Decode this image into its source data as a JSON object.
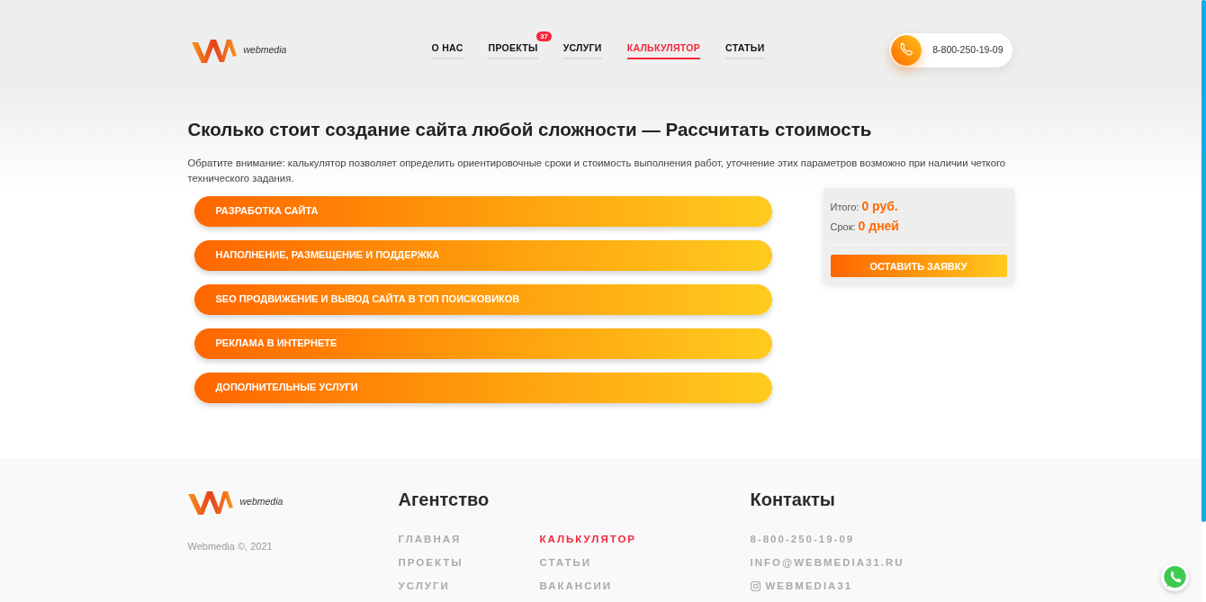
{
  "header": {
    "logo_text": "webmedia",
    "nav": [
      {
        "label": "О НАС",
        "selected": false
      },
      {
        "label": "ПРОЕКТЫ",
        "selected": false,
        "badge": "37"
      },
      {
        "label": "УСЛУГИ",
        "selected": false
      },
      {
        "label": "КАЛЬКУЛЯТОР",
        "selected": true
      },
      {
        "label": "СТАТЬИ",
        "selected": false
      }
    ],
    "phone": "8-800-250-19-09"
  },
  "calculator": {
    "title": "Сколько стоит создание сайта любой сложности — Рассчитать стоимость",
    "note": "Обратите внимание: калькулятор позволяет определить ориентировочные сроки и стоимость выполнения работ, уточнение этих параметров возможно при наличии четкого технического задания.",
    "sections": [
      {
        "label": "РАЗРАБОТКА САЙТА"
      },
      {
        "label": "НАПОЛНЕНИЕ, РАЗМЕЩЕНИЕ И ПОДДЕРЖКА"
      },
      {
        "label": "SEO ПРОДВИЖЕНИЕ И ВЫВОД САЙТА В ТОП ПОИСКОВИКОВ"
      },
      {
        "label": "РЕКЛАМА В ИНТЕРНЕТЕ"
      },
      {
        "label": "ДОПОЛНИТЕЛЬНЫЕ УСЛУГИ"
      }
    ],
    "summary": {
      "total_label": "Итого:",
      "total_value": "0 руб.",
      "term_label": "Срок:",
      "term_value": "0 дней",
      "button": "ОСТАВИТЬ ЗАЯВКУ"
    }
  },
  "footer": {
    "logo_text": "webmedia",
    "copyright": "Webmedia ©, 2021",
    "agency": {
      "title": "Агентство",
      "links": [
        {
          "label": "ГЛАВНАЯ",
          "selected": false
        },
        {
          "label": "ПРОЕКТЫ",
          "selected": false
        },
        {
          "label": "УСЛУГИ",
          "selected": false
        },
        {
          "label": "КАЛЬКУЛЯТОР",
          "selected": true
        },
        {
          "label": "СТАТЬИ",
          "selected": false
        },
        {
          "label": "ВАКАНСИИ",
          "selected": false
        }
      ]
    },
    "contacts": {
      "title": "Контакты",
      "items": [
        {
          "kind": "phone",
          "label": "8-800-250-19-09"
        },
        {
          "kind": "email",
          "label": "INFO@WEBMEDIA31.RU"
        },
        {
          "kind": "instagram",
          "label": "WEBMEDIA31"
        }
      ]
    }
  }
}
